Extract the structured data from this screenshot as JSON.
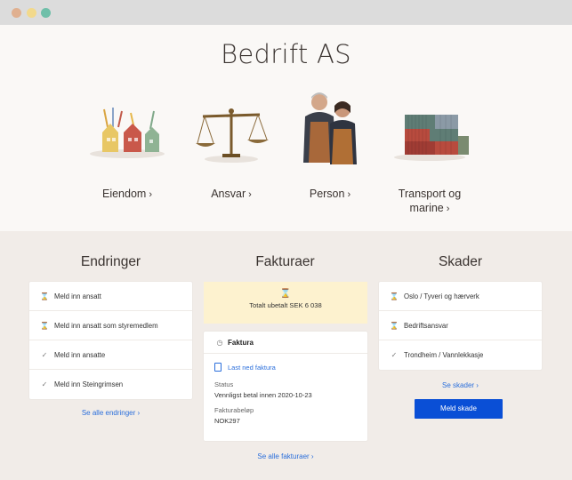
{
  "window": {},
  "header": {
    "company": "Bedrift AS"
  },
  "categories": [
    {
      "label": "Eiendom",
      "chevron": "›",
      "icon": "houses-icon"
    },
    {
      "label": "Ansvar",
      "chevron": "›",
      "icon": "scales-icon"
    },
    {
      "label": "Person",
      "chevron": "›",
      "icon": "people-photo"
    },
    {
      "label": "Transport og",
      "label2": "marine",
      "chevron": "›",
      "icon": "containers-icon"
    }
  ],
  "endringer": {
    "title": "Endringer",
    "items": [
      {
        "icon": "hourglass-icon",
        "label": "Meld inn ansatt"
      },
      {
        "icon": "hourglass-icon",
        "label": "Meld inn ansatt som styremedlem"
      },
      {
        "icon": "check-icon",
        "label": "Meld inn ansatte"
      },
      {
        "icon": "check-icon",
        "label": "Meld inn Steingrimsen"
      }
    ],
    "see_all": "Se alle endringer ›"
  },
  "fakturaer": {
    "title": "Fakturaer",
    "notice": "Totalt ubetalt SEK 6 038",
    "card_title": "Faktura",
    "download": "Last ned faktura",
    "status_label": "Status",
    "status_value": "Vennligst betal innen 2020-10-23",
    "amount_label": "Fakturabeløp",
    "amount_value": "NOK297",
    "see_all": "Se alle fakturaer ›"
  },
  "skader": {
    "title": "Skader",
    "items": [
      {
        "icon": "hourglass-icon",
        "label": "Oslo / Tyveri og hærverk"
      },
      {
        "icon": "hourglass-icon",
        "label": "Bedriftsansvar"
      },
      {
        "icon": "check-icon",
        "label": "Trondheim / Vannlekkasje"
      }
    ],
    "see_all": "Se skader ›",
    "report_button": "Meld skade"
  }
}
